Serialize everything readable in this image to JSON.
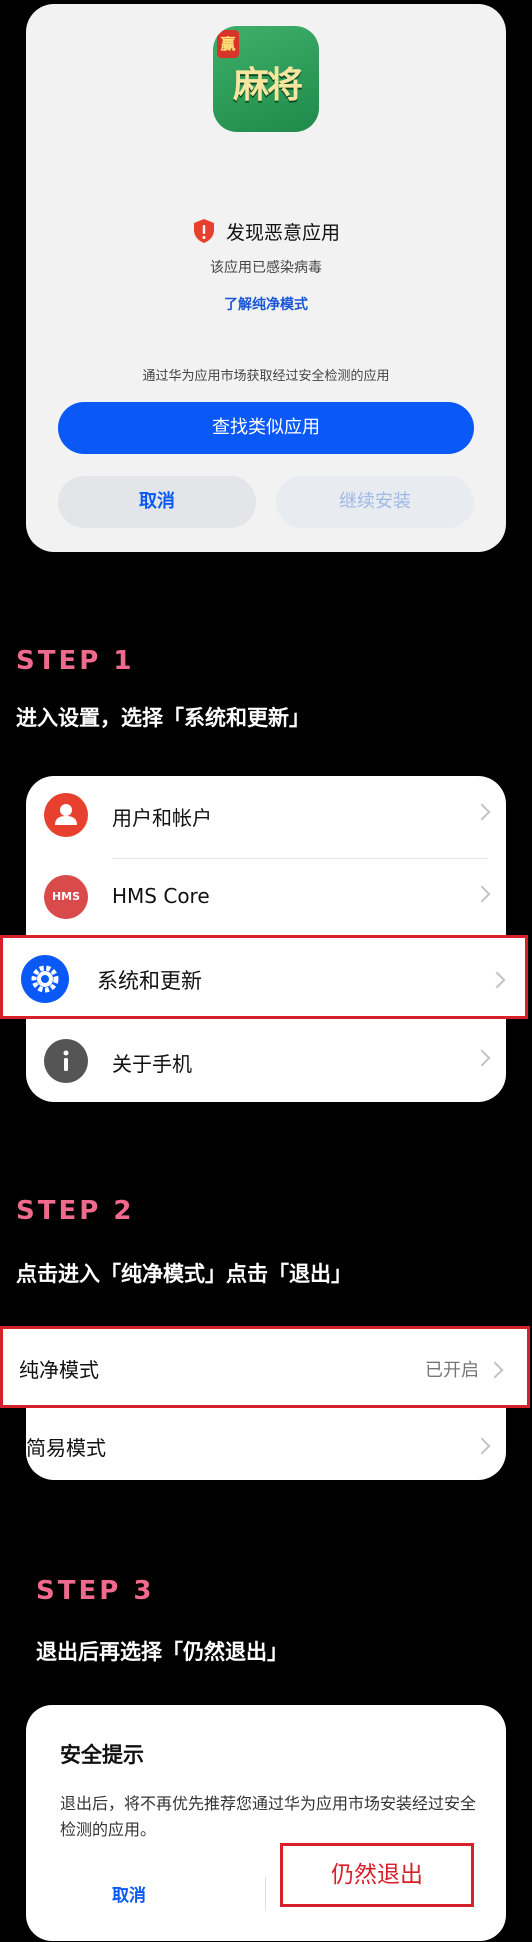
{
  "dialog1": {
    "app_icon_tag": "赢",
    "app_icon_text": "麻将",
    "warning_title": "发现恶意应用",
    "warning_sub": "该应用已感染病毒",
    "learn_link": "了解纯净模式",
    "market_text": "通过华为应用市场获取经过安全检测的应用",
    "primary_button": "查找类似应用",
    "cancel_button": "取消",
    "continue_button": "继续安装"
  },
  "step1": {
    "title": "STEP 1",
    "desc": "进入设置，选择「系统和更新」",
    "items": [
      {
        "label": "用户和帐户"
      },
      {
        "label": "HMS Core",
        "icon_text": "HMS"
      },
      {
        "label": "系统和更新"
      },
      {
        "label": "关于手机"
      }
    ]
  },
  "step2": {
    "title": "STEP 2",
    "desc": "点击进入「纯净模式」点击「退出」",
    "pure_label": "纯净模式",
    "pure_value": "已开启",
    "simple_label": "简易模式"
  },
  "step3": {
    "title": "STEP 3",
    "desc": "退出后再选择「仍然退出」"
  },
  "dialog3": {
    "title": "安全提示",
    "body": "退出后，将不再优先推荐您通过华为应用市场安装经过安全检测的应用。",
    "cancel": "取消",
    "confirm": "仍然退出"
  },
  "colors": {
    "accent": "#0a59f7",
    "highlight": "#d6202a",
    "step_title": "#f06a8d"
  }
}
